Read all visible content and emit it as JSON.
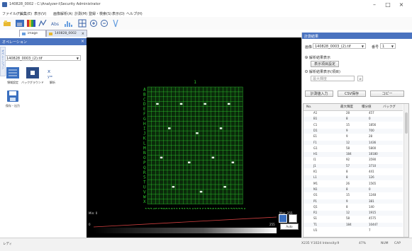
{
  "window": {
    "title": "140828_0002 - C:\\Analyzer-i\\Security Administrator",
    "minimize": "–",
    "maximize": "□",
    "close": "×"
  },
  "menu": [
    "ファイル(F)",
    "編集(E)",
    "表示(V)",
    "画像解析(A)",
    "計測(M)",
    "登録・検索(S)",
    "表示(D)",
    "ヘルプ(H)"
  ],
  "tabs": [
    {
      "label": "image"
    },
    {
      "label": "140828_0002"
    }
  ],
  "left_panel": {
    "header": "オペレーション",
    "vertical_tab": "オペレーション",
    "file_select": "140828_0003_(2).tif",
    "icons": [
      {
        "label": "領域設定",
        "icon": "grid-icon"
      },
      {
        "label": "バックグラウンド",
        "icon": "background-icon"
      },
      {
        "label": "解析",
        "icon": "analyze-icon"
      },
      {
        "label": "保存・出力",
        "icon": "save-icon"
      }
    ]
  },
  "canvas": {
    "column_numbers": "123456789101112131415161718192021222324",
    "row_letters": [
      "A",
      "B",
      "C",
      "D",
      "E",
      "F",
      "G",
      "H",
      "I",
      "J",
      "K",
      "L",
      "M",
      "N",
      "O",
      "P",
      "Q",
      "R",
      "S",
      "T",
      "U",
      "V",
      "W",
      "X"
    ],
    "top_label": "1"
  },
  "graph": {
    "min_label": "Min: 0",
    "max_label": "Max: 255",
    "left_zero": "0",
    "right_val": "255",
    "auto_label": "Auto"
  },
  "right_panel": {
    "header": "計測結果",
    "image_label": "画像",
    "image_value": "140828_0003_(2).tif",
    "series_label": "番号",
    "series_value": "1",
    "radio1": "解析結果表示",
    "button_settings": "表示項目設定",
    "radio2": "解析結果表示(項目)",
    "select_placeholder": "最大輝度",
    "btn_copy_input": "計測値入力",
    "btn_csv": "CSV保存",
    "btn_copy": "コピー",
    "columns": [
      "No.",
      "最大輝度",
      "積分値",
      "バックグ"
    ],
    "rows": [
      [
        "A1",
        "28",
        "457"
      ],
      [
        "B1",
        "8",
        "0"
      ],
      [
        "C1",
        "15",
        "1856"
      ],
      [
        "D1",
        "9",
        "700"
      ],
      [
        "E1",
        "9",
        "28"
      ],
      [
        "F1",
        "12",
        "1436"
      ],
      [
        "G1",
        "58",
        "5800"
      ],
      [
        "H1",
        "184",
        "18180"
      ],
      [
        "I1",
        "92",
        "3590"
      ],
      [
        "J1",
        "57",
        "3710"
      ],
      [
        "K1",
        "8",
        "441"
      ],
      [
        "L1",
        "8",
        "126"
      ],
      [
        "M1",
        "26",
        "1565"
      ],
      [
        "N1",
        "8",
        "0"
      ],
      [
        "O1",
        "15",
        "1248"
      ],
      [
        "P1",
        "9",
        "381"
      ],
      [
        "Q1",
        "8",
        "140"
      ],
      [
        "R1",
        "12",
        "1915"
      ],
      [
        "S1",
        "58",
        "4575"
      ],
      [
        "T1",
        "184",
        "10447"
      ],
      [
        "U1",
        "",
        "7"
      ]
    ]
  },
  "status": {
    "left": "レディ",
    "coords": "X235  Y:1024  Intensity:9",
    "zoom": "47%",
    "mode": "NUM",
    "caps": "CAP"
  },
  "colors": {
    "accent": "#4a73c0",
    "grid": "#2fd12f",
    "canvas_bg": "#000000"
  }
}
